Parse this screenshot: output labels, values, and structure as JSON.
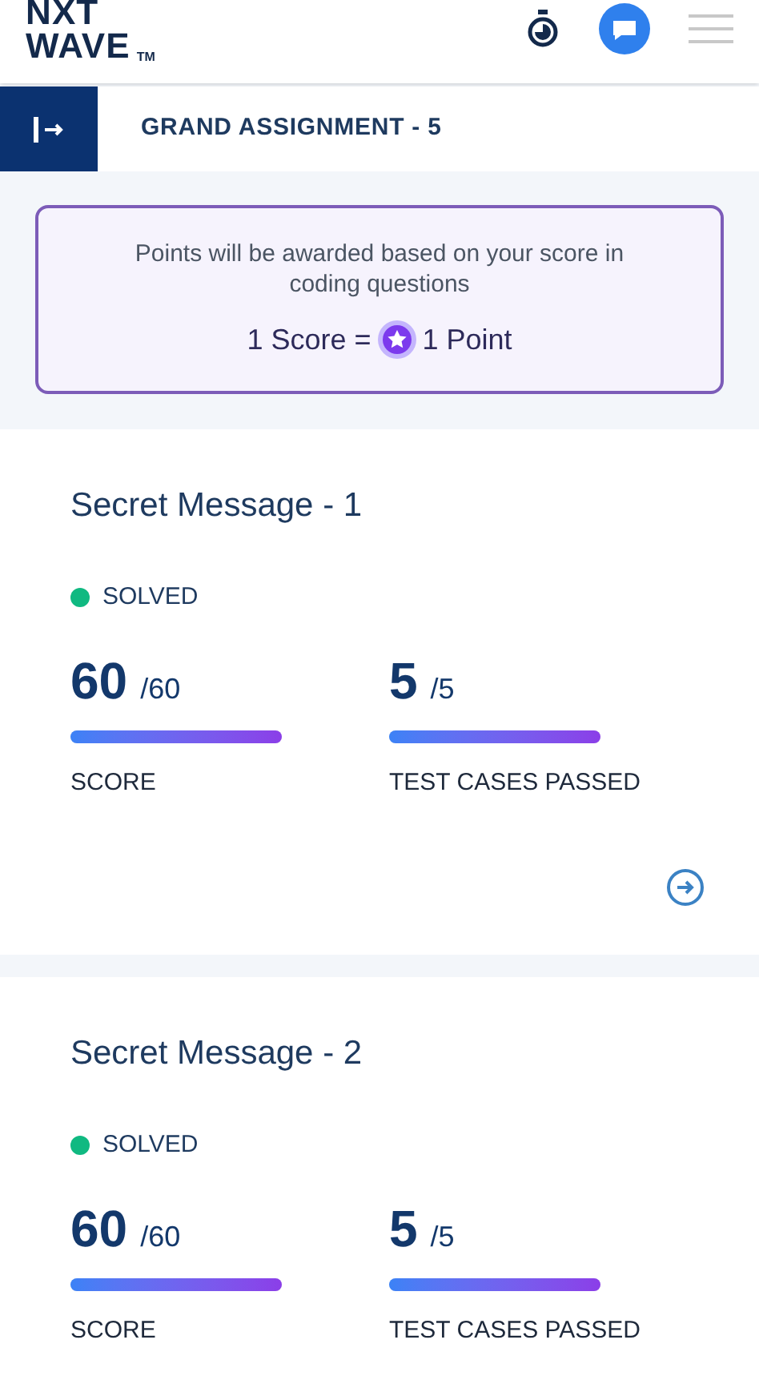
{
  "logo": {
    "top": "NXT",
    "bottom": "WAVE",
    "mark": "TM"
  },
  "title": "GRAND ASSIGNMENT - 5",
  "info": {
    "text": "Points will be awarded based on your score in coding questions",
    "left": "1 Score =",
    "right": "1 Point"
  },
  "questions": [
    {
      "title": "Secret Message - 1",
      "status": "SOLVED",
      "solved": true,
      "show_arrow": true,
      "metrics": [
        {
          "value": "60",
          "total": "/60",
          "label": "SCORE",
          "level": 1
        },
        {
          "value": "5",
          "total": "/5",
          "label": "TEST CASES PASSED",
          "level": 1
        }
      ]
    },
    {
      "title": "Secret Message - 2",
      "status": "SOLVED",
      "solved": true,
      "show_arrow": false,
      "metrics": [
        {
          "value": "60",
          "total": "/60",
          "label": "SCORE",
          "level": 1
        },
        {
          "value": "5",
          "total": "/5",
          "label": "TEST CASES PASSED",
          "level": 1
        }
      ]
    }
  ]
}
